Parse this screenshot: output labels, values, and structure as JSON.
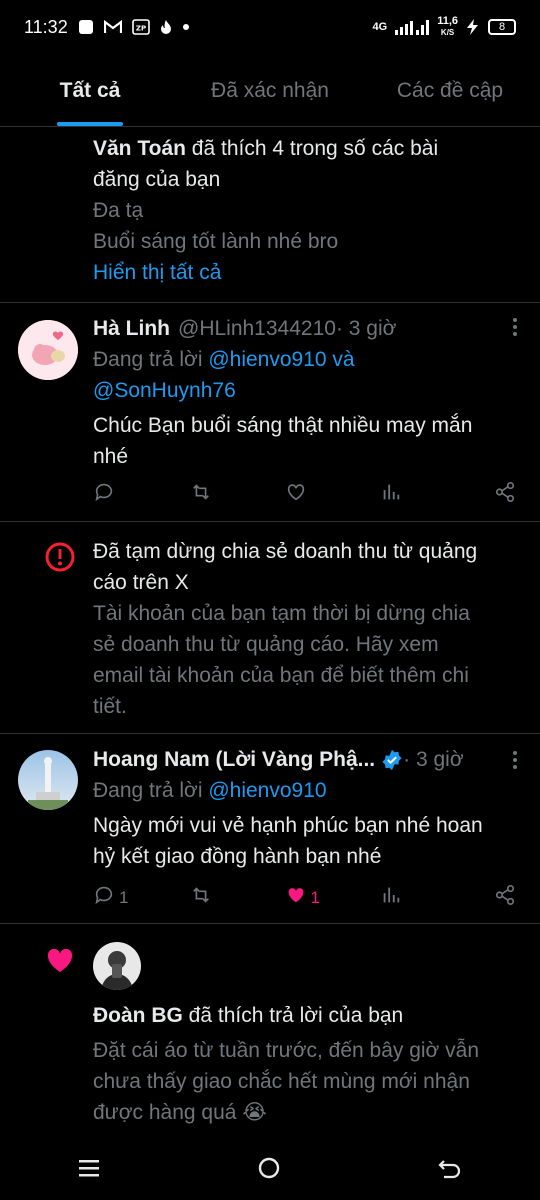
{
  "status_bar": {
    "time": "11:32",
    "network": "4G",
    "speed_top": "11,6",
    "speed_bottom": "K/S",
    "battery": "8",
    "icons": [
      "square-notification-icon",
      "gmail-icon",
      "zalo-pay-icon",
      "fire-icon",
      "dot-icon"
    ]
  },
  "tabs": [
    {
      "label": "Tất cả",
      "active": true
    },
    {
      "label": "Đã xác nhận",
      "active": false
    },
    {
      "label": "Các đề cập",
      "active": false
    }
  ],
  "notification_1": {
    "user": "Văn Toán",
    "action_line1": " đã thích 4 trong số các bài",
    "action_line2": "đăng của bạn",
    "preview1": "Đa tạ",
    "preview2": "Buổi sáng tốt lành nhé bro",
    "show_all": "Hiển thị tất cả"
  },
  "reply_1": {
    "name": "Hà Linh",
    "handle": "@HLinh1344210",
    "time": " · 3 giờ",
    "replying_to": "Đang trả lời ",
    "mention1": "@hienvo910",
    "and": " và",
    "mention2": "@SonHuynh76",
    "text_line1": "Chúc Bạn buổi sáng thật nhiều may mắn",
    "text_line2": "nhé",
    "reply_count": "",
    "like_count": ""
  },
  "notice": {
    "title_line1": "Đã tạm dừng chia sẻ doanh thu từ quảng",
    "title_line2": "cáo trên X",
    "body_line1": "Tài khoản của bạn tạm thời bị dừng chia",
    "body_line2": "sẻ doanh thu từ quảng cáo. Hãy xem",
    "body_line3": "email tài khoản của bạn để biết thêm chi",
    "body_line4": "tiết."
  },
  "reply_2": {
    "name": "Hoang Nam (Lời Vàng Phậ...",
    "time": " · 3 giờ",
    "replying_to": "Đang trả lời ",
    "mention1": "@hienvo910",
    "text_line1": "Ngày mới vui vẻ hạnh phúc bạn nhé hoan",
    "text_line2": "hỷ kết giao đồng hành bạn nhé",
    "reply_count": "1",
    "like_count": "1"
  },
  "notification_2": {
    "user": "Đoàn BG",
    "action": " đã thích trả lời của bạn",
    "preview_line1": "Đặt cái áo từ tuần trước, đến bây giờ vẫn",
    "preview_line2": "chưa thấy giao chắc hết mùng mới nhận",
    "preview_line3": "được hàng quá 😭"
  },
  "colors": {
    "background": "#000000",
    "text": "#e7e9ea",
    "secondary": "#71767b",
    "accent": "#1d9bf0",
    "like": "#f91880",
    "alert": "#f4212e"
  }
}
